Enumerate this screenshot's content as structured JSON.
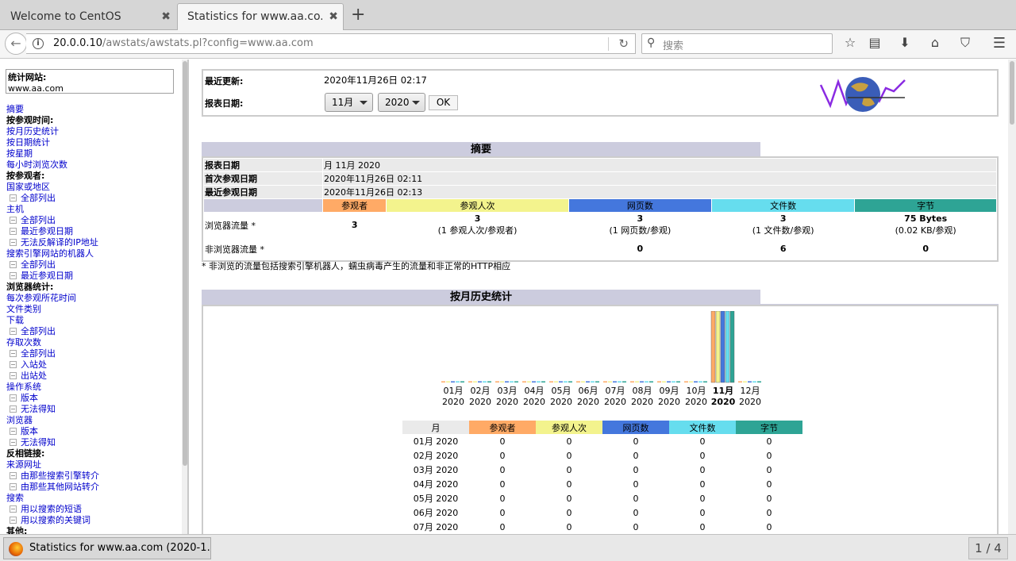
{
  "browser": {
    "tabs": [
      {
        "label": "Welcome to CentOS",
        "active": false
      },
      {
        "label": "Statistics for www.aa.co...",
        "active": true
      }
    ],
    "url_host": "20.0.0.10",
    "url_path": "/awstats/awstats.pl?config=www.aa.com",
    "search_placeholder": "搜索",
    "icons": [
      "back-arrow-icon",
      "info-icon",
      "reload-icon",
      "search-icon",
      "star-icon",
      "reading-list-icon",
      "download-icon",
      "home-icon",
      "pocket-icon",
      "menu-icon"
    ]
  },
  "sidebar": {
    "site_label": "统计网站:",
    "site_value": "www.aa.com",
    "items": [
      {
        "t": "l",
        "label": "摘要"
      },
      {
        "t": "h",
        "label": "按参观时间:"
      },
      {
        "t": "l",
        "label": "按月历史统计"
      },
      {
        "t": "l",
        "label": "按日期统计"
      },
      {
        "t": "l",
        "label": "按星期"
      },
      {
        "t": "l",
        "label": "每小时浏览次数"
      },
      {
        "t": "h",
        "label": "按参观者:"
      },
      {
        "t": "l",
        "label": "国家或地区"
      },
      {
        "t": "s",
        "label": "全部列出"
      },
      {
        "t": "l",
        "label": "主机"
      },
      {
        "t": "s",
        "label": "全部列出"
      },
      {
        "t": "s",
        "label": "最近参观日期"
      },
      {
        "t": "s",
        "label": "无法反解译的IP地址"
      },
      {
        "t": "l",
        "label": "搜索引擎网站的机器人"
      },
      {
        "t": "s",
        "label": "全部列出"
      },
      {
        "t": "s",
        "label": "最近参观日期"
      },
      {
        "t": "h",
        "label": "浏览器统计:"
      },
      {
        "t": "l",
        "label": "每次参观所花时间"
      },
      {
        "t": "l",
        "label": "文件类别"
      },
      {
        "t": "l",
        "label": "下载"
      },
      {
        "t": "s",
        "label": "全部列出"
      },
      {
        "t": "l",
        "label": "存取次数"
      },
      {
        "t": "s",
        "label": "全部列出"
      },
      {
        "t": "s",
        "label": "入站处"
      },
      {
        "t": "s",
        "label": "出站处"
      },
      {
        "t": "l",
        "label": "操作系统"
      },
      {
        "t": "s",
        "label": "版本"
      },
      {
        "t": "s",
        "label": "无法得知"
      },
      {
        "t": "l",
        "label": "浏览器"
      },
      {
        "t": "s",
        "label": "版本"
      },
      {
        "t": "s",
        "label": "无法得知"
      },
      {
        "t": "h",
        "label": "反相链接:"
      },
      {
        "t": "l",
        "label": "来源网址"
      },
      {
        "t": "s",
        "label": "由那些搜索引擎转介"
      },
      {
        "t": "s",
        "label": "由那些其他网站转介"
      },
      {
        "t": "l",
        "label": "搜索"
      },
      {
        "t": "s",
        "label": "用以搜索的短语"
      },
      {
        "t": "s",
        "label": "用以搜索的关键词"
      },
      {
        "t": "h",
        "label": "其他:"
      }
    ]
  },
  "header": {
    "last_update_label": "最近更新:",
    "last_update_value": "2020年11月26日 02:17",
    "report_date_label": "报表日期:",
    "month_select": "11月",
    "year_select": "2020",
    "ok_label": "OK"
  },
  "summary": {
    "title": "摘要",
    "report_date_label": "报表日期",
    "report_date_value": "月 11月 2020",
    "first_visit_label": "首次参观日期",
    "first_visit_value": "2020年11月26日 02:11",
    "last_visit_label": "最近参观日期",
    "last_visit_value": "2020年11月26日 02:13",
    "columns": [
      "参观者",
      "参观人次",
      "网页数",
      "文件数",
      "字节"
    ],
    "viewed_label": "浏览器流量 *",
    "viewed": [
      {
        "main": "3",
        "sub": ""
      },
      {
        "main": "3",
        "sub": "(1 参观人次/参观者)"
      },
      {
        "main": "3",
        "sub": "(1 网页数/参观)"
      },
      {
        "main": "3",
        "sub": "(1 文件数/参观)"
      },
      {
        "main": "75 Bytes",
        "sub": "(0.02 KB/参观)"
      }
    ],
    "not_viewed_label": "非浏览器流量 *",
    "not_viewed": [
      "",
      "",
      "0",
      "6",
      "0"
    ],
    "footnote": "* 非浏览的流量包括搜索引擎机器人，蠕虫病毒产生的流量和非正常的HTTP相应"
  },
  "history": {
    "title": "按月历史统计",
    "columns": [
      "月",
      "参观者",
      "参观人次",
      "网页数",
      "文件数",
      "字节"
    ],
    "rows": [
      [
        "01月 2020",
        "0",
        "0",
        "0",
        "0",
        "0"
      ],
      [
        "02月 2020",
        "0",
        "0",
        "0",
        "0",
        "0"
      ],
      [
        "03月 2020",
        "0",
        "0",
        "0",
        "0",
        "0"
      ],
      [
        "04月 2020",
        "0",
        "0",
        "0",
        "0",
        "0"
      ],
      [
        "05月 2020",
        "0",
        "0",
        "0",
        "0",
        "0"
      ],
      [
        "06月 2020",
        "0",
        "0",
        "0",
        "0",
        "0"
      ],
      [
        "07月 2020",
        "0",
        "0",
        "0",
        "0",
        "0"
      ]
    ]
  },
  "chart_data": {
    "type": "bar",
    "categories": [
      "01月",
      "02月",
      "03月",
      "04月",
      "05月",
      "06月",
      "07月",
      "08月",
      "09月",
      "10月",
      "11月",
      "12月"
    ],
    "category_year": "2020",
    "highlight": "11月",
    "series": [
      {
        "name": "参观者",
        "color": "#ffaa66",
        "values": [
          0,
          0,
          0,
          0,
          0,
          0,
          0,
          0,
          0,
          0,
          3,
          0
        ]
      },
      {
        "name": "参观人次",
        "color": "#f3f38d",
        "values": [
          0,
          0,
          0,
          0,
          0,
          0,
          0,
          0,
          0,
          0,
          3,
          0
        ]
      },
      {
        "name": "网页数",
        "color": "#4477dd",
        "values": [
          0,
          0,
          0,
          0,
          0,
          0,
          0,
          0,
          0,
          0,
          3,
          0
        ]
      },
      {
        "name": "文件数",
        "color": "#66ddee",
        "values": [
          0,
          0,
          0,
          0,
          0,
          0,
          0,
          0,
          0,
          0,
          3,
          0
        ]
      },
      {
        "name": "字节",
        "color": "#2ea495",
        "values": [
          0,
          0,
          0,
          0,
          0,
          0,
          0,
          0,
          0,
          0,
          75,
          0
        ]
      }
    ]
  },
  "colors": {
    "visitors": "#ffaa66",
    "visits": "#f3f38d",
    "pages": "#4477dd",
    "files": "#66ddee",
    "bytes": "#2ea495",
    "section": "#ccccde"
  },
  "taskbar": {
    "window_title": "Statistics for www.aa.com (2020-1…",
    "workspace": "1 / 4"
  }
}
